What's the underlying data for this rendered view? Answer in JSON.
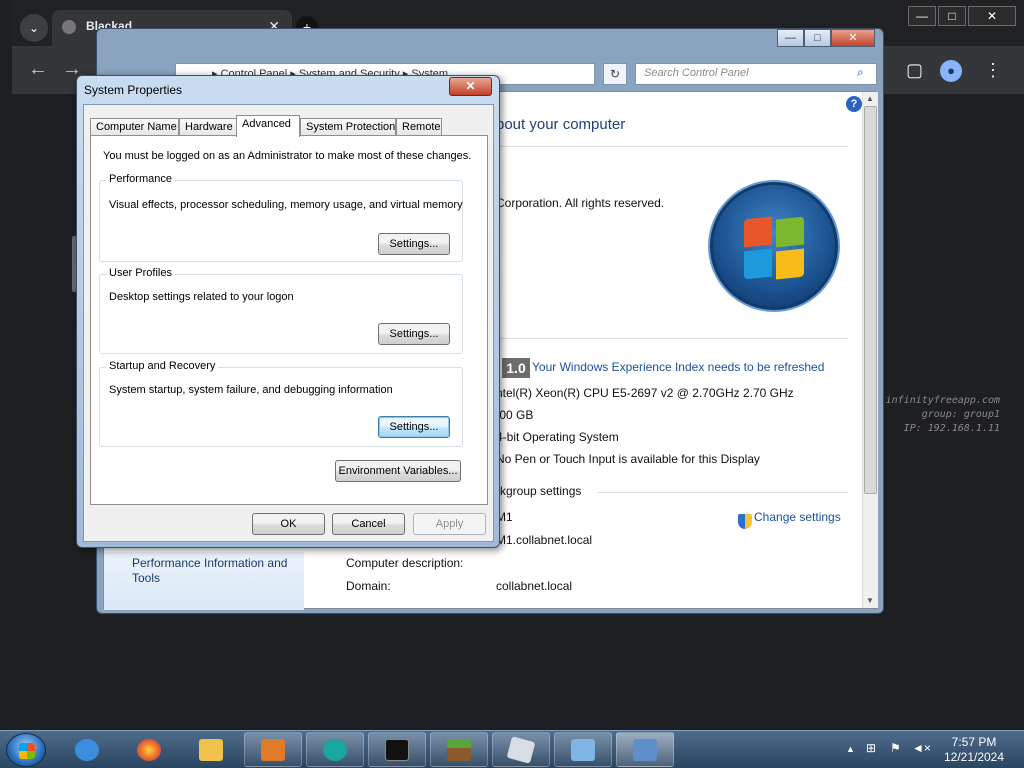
{
  "browser": {
    "tab_title": "Blackad",
    "tab_close": "✕",
    "new_tab": "+",
    "tab_menu": "⌄",
    "window_controls": {
      "minimize": "—",
      "maximize": "□",
      "close": "✕"
    },
    "back": "←",
    "forward": "→",
    "side_panel_icon": "▢",
    "account_icon": "●",
    "menu_icon": "⋮"
  },
  "watermark": {
    "line1": "infinityfreeapp.com",
    "line2": "group: group1",
    "line3": "IP: 192.168.1.11"
  },
  "control_panel": {
    "window_controls": {
      "minimize": "—",
      "maximize": "□",
      "close": "✕"
    },
    "breadcrumb": "▸ Control Panel  ▸ System and Security  ▸ System",
    "refresh": "↻",
    "search_placeholder": "Search Control Panel",
    "help": "?",
    "heading_partial": "bout your computer",
    "copyright_partial": "Corporation.  All rights reserved.",
    "rating_badge": "1.0",
    "wei_link": "Your Windows Experience Index needs to be refreshed",
    "processor": "ntel(R) Xeon(R) CPU E5-2697 v2 @ 2.70GHz   2.70 GHz",
    "memory": ".00 GB",
    "system_type": "4-bit Operating System",
    "pen_touch": "No Pen or Touch Input is available for this Display",
    "workgroup_section": "rkgroup settings",
    "computer_name_partial": "M1",
    "full_name_partial": "M1.collabnet.local",
    "change_settings": "Change settings",
    "computer_description_label": "Computer description:",
    "domain_label": "Domain:",
    "domain_value": "collabnet.local",
    "sidebar_link": "Performance Information and Tools"
  },
  "system_properties": {
    "title": "System Properties",
    "close": "✕",
    "tabs": [
      "Computer Name",
      "Hardware",
      "Advanced",
      "System Protection",
      "Remote"
    ],
    "active_tab": "Advanced",
    "admin_note": "You must be logged on as an Administrator to make most of these changes.",
    "performance": {
      "label": "Performance",
      "description": "Visual effects, processor scheduling, memory usage, and virtual memory",
      "button": "Settings..."
    },
    "user_profiles": {
      "label": "User Profiles",
      "description": "Desktop settings related to your logon",
      "button": "Settings..."
    },
    "startup_recovery": {
      "label": "Startup and Recovery",
      "description": "System startup, system failure, and debugging information",
      "button": "Settings..."
    },
    "environment_variables": "Environment Variables...",
    "ok": "OK",
    "cancel": "Cancel",
    "apply": "Apply"
  },
  "taskbar": {
    "time": "7:57 PM",
    "date": "12/21/2024",
    "tray_show_hidden": "▲",
    "tray_network": "⊞",
    "tray_flag": "⚑",
    "tray_volume": "◄×"
  }
}
